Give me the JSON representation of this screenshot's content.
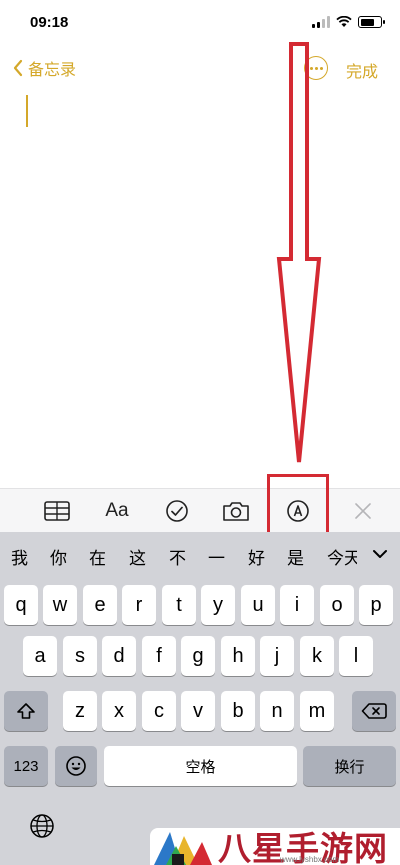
{
  "status_bar": {
    "time": "09:18"
  },
  "nav": {
    "back_label": "备忘录",
    "done_label": "完成"
  },
  "toolbar": {
    "format_label": "Aa"
  },
  "candidates": [
    "我",
    "你",
    "在",
    "这",
    "不",
    "一",
    "好",
    "是",
    "今天"
  ],
  "keyboard": {
    "row1": [
      "q",
      "w",
      "e",
      "r",
      "t",
      "y",
      "u",
      "i",
      "o",
      "p"
    ],
    "row2": [
      "a",
      "s",
      "d",
      "f",
      "g",
      "h",
      "j",
      "k",
      "l"
    ],
    "row3": [
      "z",
      "x",
      "c",
      "v",
      "b",
      "n",
      "m"
    ],
    "numbers_label": "123",
    "space_label": "空格",
    "return_label": "换行"
  },
  "watermark": {
    "text": "八星手游网",
    "url": "www.lyshbx.com"
  },
  "colors": {
    "accent": "#d4a82a",
    "annotation": "#d42a33"
  }
}
